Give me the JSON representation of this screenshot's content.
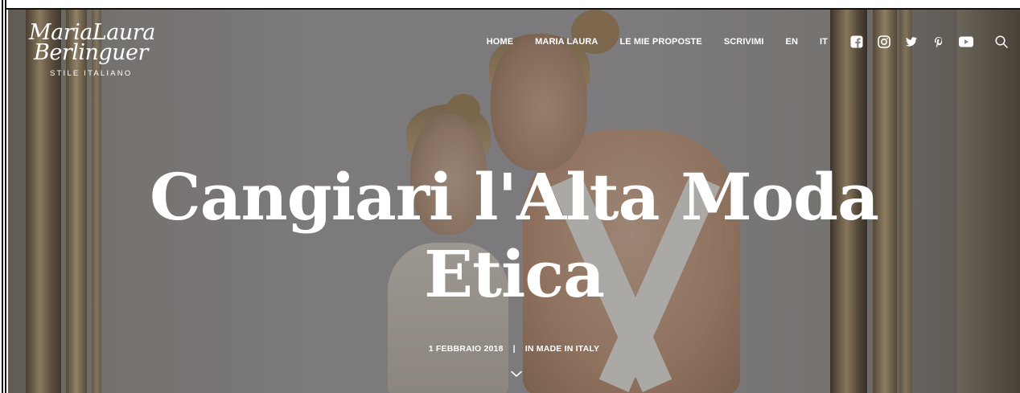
{
  "header": {
    "logo": {
      "name_line1": "MariaLaura",
      "name_line2": "Berlinguer",
      "tagline": "STILE ITALIANO"
    },
    "nav": {
      "items": [
        {
          "label": "HOME"
        },
        {
          "label": "MARIA LAURA"
        },
        {
          "label": "LE MIE PROPOSTE"
        },
        {
          "label": "SCRIVIMI"
        },
        {
          "label": "EN"
        },
        {
          "label": "IT"
        }
      ],
      "social_icons": [
        "facebook-icon",
        "instagram-icon",
        "twitter-icon",
        "pinterest-icon",
        "youtube-icon"
      ],
      "search_icon": "search-icon"
    }
  },
  "hero": {
    "title_line1": "Cangiari l'Alta Moda",
    "title_line2": "Etica",
    "date": "1 FEBBRAIO 2018",
    "separator": "|",
    "category": "IN MADE IN ITALY",
    "scroll_icon": "chevron-down-icon"
  },
  "colors": {
    "text": "#ffffff",
    "overlay": "rgba(40,36,32,0.34)"
  }
}
